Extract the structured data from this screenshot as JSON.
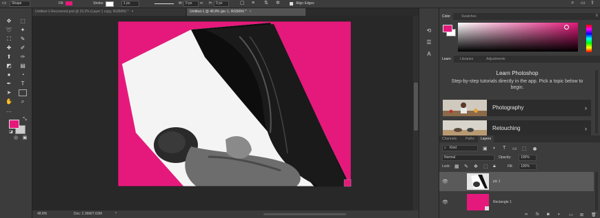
{
  "options_bar": {
    "mode": "Shape",
    "fill_label": "Fill:",
    "stroke_label": "Stroke:",
    "stroke_size": "1 px",
    "w_label": "W:",
    "w_value": "0 px",
    "h_label": "H:",
    "h_value": "0 px",
    "align_edges": "Align Edges"
  },
  "tabs": [
    {
      "label": "Untitled-1-Recovered.psd @ 33.3% (Layer 1 copy, RGB/8#) *",
      "close": "×"
    },
    {
      "label": "Untitled-1 @ 48.8% (pic 1, RGB/8#) *",
      "close": "×"
    }
  ],
  "status": {
    "zoom": "48.8%",
    "doc": "Doc: 2.36M/7.63M"
  },
  "color_panel": {
    "tabs": [
      "Color",
      "Swatches"
    ],
    "foreground": "#e5197c",
    "background": "#ffffff",
    "hue_color": "#e5197c"
  },
  "learn_panel": {
    "tabs": [
      "Learn",
      "Libraries",
      "Adjustments"
    ],
    "title": "Learn Photoshop",
    "description": "Step-by-step tutorials directly in the app. Pick a topic below to begin.",
    "cards": [
      {
        "label": "Photography",
        "chevron": "›"
      },
      {
        "label": "Retouching",
        "chevron": "›"
      }
    ]
  },
  "layers_panel": {
    "tabs": [
      "Channels",
      "Paths",
      "Layers"
    ],
    "kind_label": "Kind",
    "blend_mode": "Normal",
    "opacity_label": "Opacity:",
    "opacity_value": "100%",
    "lock_label": "Lock:",
    "fill_label": "Fill:",
    "fill_value": "100%",
    "layers": [
      {
        "name": "pic 1",
        "selected": true
      },
      {
        "name": "Rectangle 1",
        "selected": false
      }
    ]
  },
  "accent_color": "#e5197c"
}
